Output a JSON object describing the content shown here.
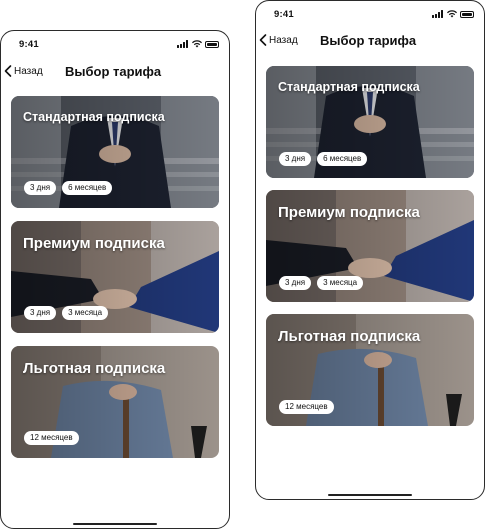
{
  "status": {
    "time": "9:41"
  },
  "nav": {
    "back_label": "Назад",
    "title": "Выбор тарифа"
  },
  "cards": [
    {
      "title": "Стандартная подписка",
      "chips": [
        "3 дня",
        "6 месяцев"
      ]
    },
    {
      "title": "Премиум подписка",
      "chips": [
        "3 дня",
        "3 месяца"
      ]
    },
    {
      "title": "Льготная подписка",
      "chips": [
        "12 месяцев"
      ]
    }
  ],
  "colors": {
    "text": "#111111",
    "chip_bg": "#ffffff",
    "card_title": "#ffffff",
    "frame": "#2b2b2b"
  }
}
